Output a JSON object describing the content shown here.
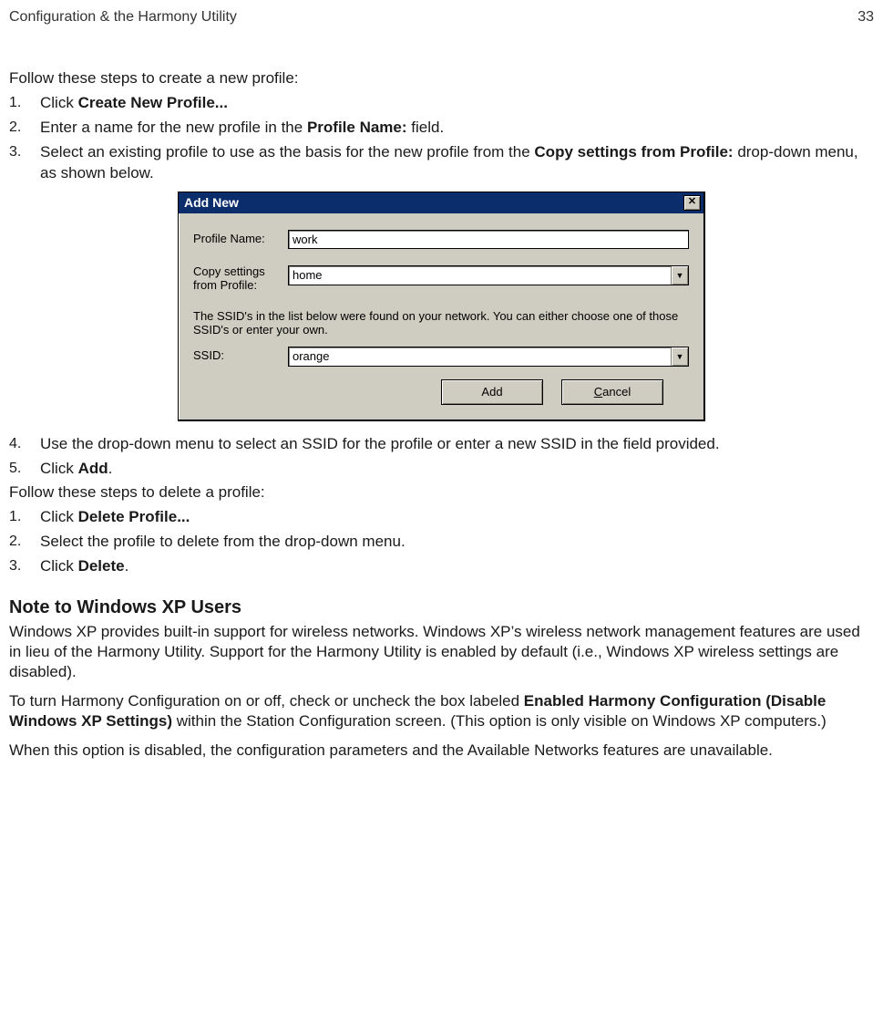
{
  "header": {
    "section_title": "Configuration & the Harmony Utility",
    "page_number": "33"
  },
  "intro_create": "Follow these steps to create a new profile:",
  "create_steps": [
    {
      "pre": "Click ",
      "bold": "Create New Profile...",
      "post": ""
    },
    {
      "pre": "Enter a name for the new profile in the ",
      "bold": "Profile Name:",
      "post": " field."
    },
    {
      "pre": "Select an existing profile to use as the basis for the new profile from the ",
      "bold": "Copy settings from Profile:",
      "post": " drop-down menu, as shown below."
    }
  ],
  "dialog": {
    "title": "Add New",
    "profile_label": "Profile Name:",
    "profile_value": "work",
    "copy_label": "Copy settings from Profile:",
    "copy_value": "home",
    "help_text": "The SSID's in the list below were found on your network. You can either choose one of those SSID's or enter your own.",
    "ssid_label": "SSID:",
    "ssid_value": "orange",
    "add_button": "Add",
    "cancel_prefix": "C",
    "cancel_rest": "ancel"
  },
  "post_steps": [
    {
      "pre": "Use the drop-down menu to select an SSID for the profile or enter a new SSID in the field provided.",
      "bold": "",
      "post": ""
    },
    {
      "pre": "Click ",
      "bold": "Add",
      "post": "."
    }
  ],
  "intro_delete": "Follow these steps to delete a profile:",
  "delete_steps": [
    {
      "pre": "Click ",
      "bold": "Delete Profile...",
      "post": ""
    },
    {
      "pre": "Select the profile to delete from the drop-down menu.",
      "bold": "",
      "post": ""
    },
    {
      "pre": "Click ",
      "bold": "Delete",
      "post": "."
    }
  ],
  "xp_section": {
    "heading": "Note to Windows XP Users",
    "p1": "Windows XP provides built-in support for wireless networks. Windows XP’s wireless network management features are used in lieu of the Harmony Utility. Support for the Harmony Utility is enabled by default (i.e., Windows XP wireless settings are disabled).",
    "p2_pre": "To turn Harmony Configuration on or off, check or uncheck the box labeled ",
    "p2_bold": "Enabled Harmony Configuration (Disable Windows XP Settings)",
    "p2_post": " within the Station Configuration screen. (This option is only visible on Windows XP computers.)",
    "p3": "When this option is disabled, the configuration parameters and the Available Networks features are unavailable."
  }
}
